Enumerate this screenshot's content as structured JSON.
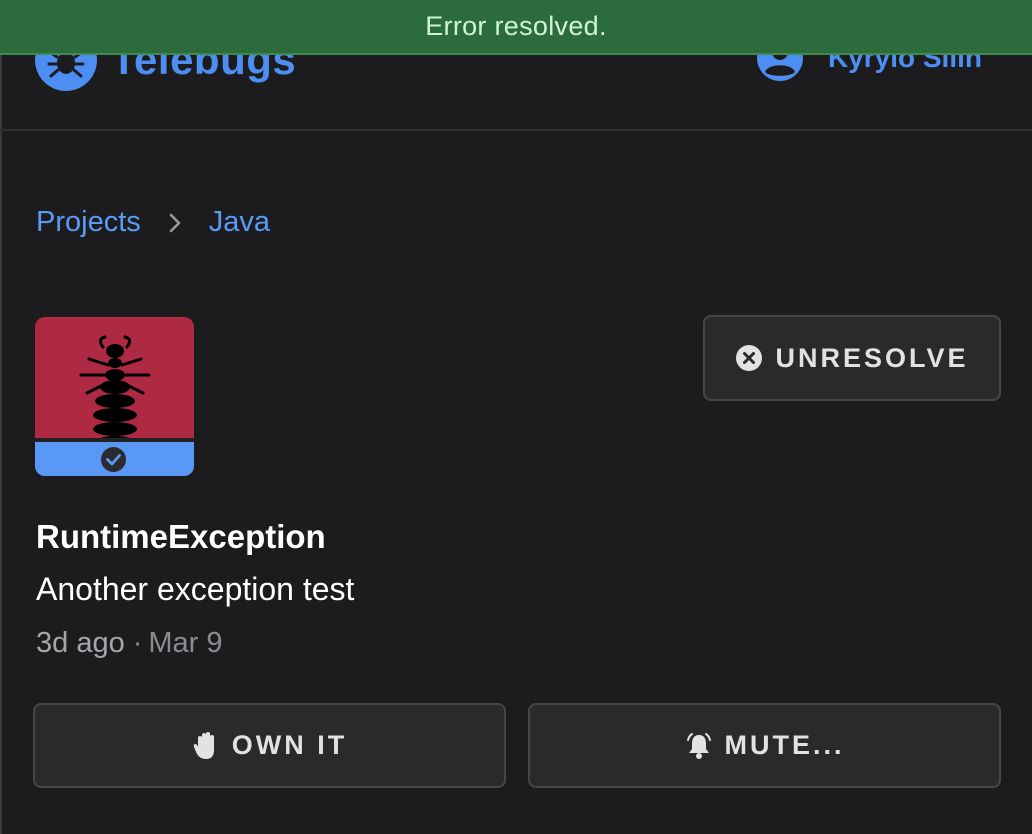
{
  "toast": {
    "message": "Error resolved."
  },
  "header": {
    "brand_name": "Telebugs",
    "logo_icon": "bug-icon",
    "user_icon": "user-circle-icon",
    "user_name": "Kyrylo Silin"
  },
  "breadcrumb": {
    "items": [
      "Projects",
      "Java"
    ],
    "separator_icon": "chevron-right-icon"
  },
  "error": {
    "status_icon": "check-circle-icon",
    "title": "RuntimeException",
    "message": "Another exception test",
    "relative_time": "3d ago",
    "separator": "·",
    "date": "Mar 9"
  },
  "actions": {
    "unresolve_label": "UNRESOLVE",
    "unresolve_icon": "x-circle-icon",
    "own_label": "OWN IT",
    "own_icon": "hand-icon",
    "mute_label": "MUTE...",
    "mute_icon": "bell-icon"
  },
  "colors": {
    "accent": "#4d8ef3",
    "tile_red": "#ae2a43",
    "toast_green": "#2c6b3c",
    "background": "#1c1c1f"
  }
}
